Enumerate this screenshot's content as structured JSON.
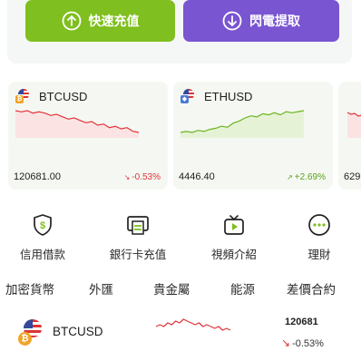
{
  "actions": {
    "deposit_label": "快速充值",
    "withdraw_label": "閃電提取",
    "deposit_color": "#7fbf1f",
    "withdraw_color": "#7a55d1"
  },
  "markets": [
    {
      "symbol": "BTCUSD",
      "price": "120681.00",
      "change": "-0.53%",
      "direction": "down",
      "trend": [
        10,
        11,
        10,
        12,
        11,
        12,
        14,
        13,
        15,
        17,
        16,
        18,
        20,
        19,
        22,
        21,
        24,
        23,
        25,
        24,
        27,
        28
      ]
    },
    {
      "symbol": "ETHUSD",
      "price": "4446.40",
      "change": "+2.69%",
      "direction": "up",
      "trend": [
        26,
        25,
        26,
        24,
        25,
        23,
        22,
        20,
        21,
        17,
        15,
        12,
        10,
        11,
        8,
        9,
        7,
        9,
        6,
        7,
        6,
        5
      ]
    },
    {
      "symbol": "",
      "price": "629",
      "change": "",
      "direction": "down",
      "trend": []
    }
  ],
  "quick_nav": [
    {
      "label": "信用借款",
      "icon": "shield-dollar-icon"
    },
    {
      "label": "銀行卡充值",
      "icon": "bank-card-icon"
    },
    {
      "label": "視頻介紹",
      "icon": "video-play-icon"
    },
    {
      "label": "理財",
      "icon": "ellipsis-circle-icon"
    }
  ],
  "tabs": [
    "加密貨幣",
    "外匯",
    "貴金屬",
    "能源",
    "差價合約"
  ],
  "list": [
    {
      "symbol": "BTCUSD",
      "price": "120681",
      "change": "-0.53%",
      "direction": "down",
      "trend": [
        10,
        9,
        10,
        8,
        9,
        7,
        8,
        6,
        7,
        8,
        9,
        8,
        10,
        9,
        10,
        11,
        10,
        12,
        11,
        12
      ]
    }
  ]
}
